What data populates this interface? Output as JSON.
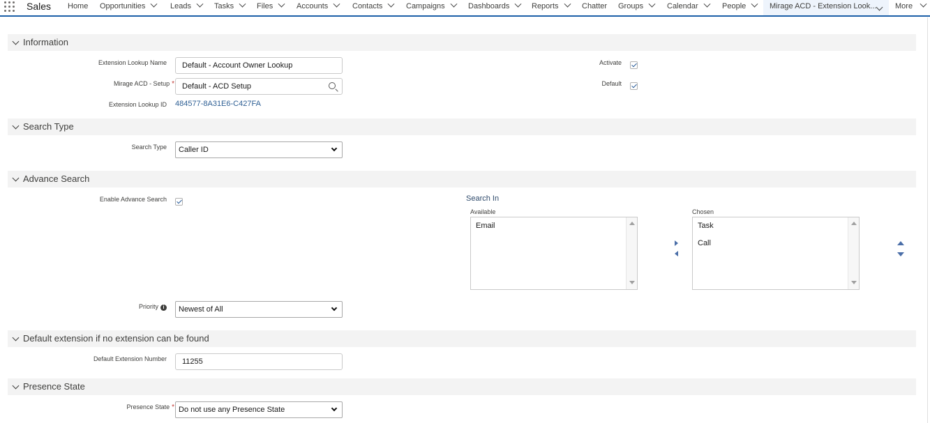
{
  "app": {
    "name": "Sales"
  },
  "nav": {
    "items": [
      {
        "label": "Home",
        "has_menu": false
      },
      {
        "label": "Opportunities",
        "has_menu": true
      },
      {
        "label": "Leads",
        "has_menu": true
      },
      {
        "label": "Tasks",
        "has_menu": true
      },
      {
        "label": "Files",
        "has_menu": true
      },
      {
        "label": "Accounts",
        "has_menu": true
      },
      {
        "label": "Contacts",
        "has_menu": true
      },
      {
        "label": "Campaigns",
        "has_menu": true
      },
      {
        "label": "Dashboards",
        "has_menu": true
      },
      {
        "label": "Reports",
        "has_menu": true
      },
      {
        "label": "Chatter",
        "has_menu": false
      },
      {
        "label": "Groups",
        "has_menu": true
      },
      {
        "label": "Calendar",
        "has_menu": true
      },
      {
        "label": "People",
        "has_menu": true
      },
      {
        "label": "Mirage ACD - Extension Look...",
        "has_menu": true,
        "active": true
      }
    ],
    "more_label": "More"
  },
  "sections": {
    "information": {
      "title": "Information",
      "extension_lookup_name_label": "Extension Lookup Name",
      "extension_lookup_name_value": "Default - Account Owner Lookup",
      "mirage_acd_setup_label": "Mirage ACD - Setup",
      "mirage_acd_setup_value": "Default - ACD Setup",
      "extension_lookup_id_label": "Extension Lookup ID",
      "extension_lookup_id_value": "484577-8A31E6-C427FA",
      "activate_label": "Activate",
      "activate_checked": true,
      "default_label": "Default",
      "default_checked": true
    },
    "search_type": {
      "title": "Search Type",
      "search_type_label": "Search Type",
      "search_type_value": "Caller ID"
    },
    "advance_search": {
      "title": "Advance Search",
      "enable_label": "Enable Advance Search",
      "enable_checked": true,
      "search_in_label": "Search In",
      "available_label": "Available",
      "available_items": [
        "Email"
      ],
      "chosen_label": "Chosen",
      "chosen_items": [
        "Task",
        "Call"
      ],
      "priority_label": "Priority",
      "priority_value": "Newest of All"
    },
    "default_extension": {
      "title": "Default extension if no extension can be found",
      "number_label": "Default Extension Number",
      "number_value": "11255"
    },
    "presence_state": {
      "title": "Presence State",
      "presence_label": "Presence State",
      "presence_value": "Do not use any Presence State"
    }
  },
  "colors": {
    "accent": "#1b5fa8",
    "link": "#2e5f94",
    "required": "#c23934",
    "section_bg": "#f3f3f3"
  }
}
